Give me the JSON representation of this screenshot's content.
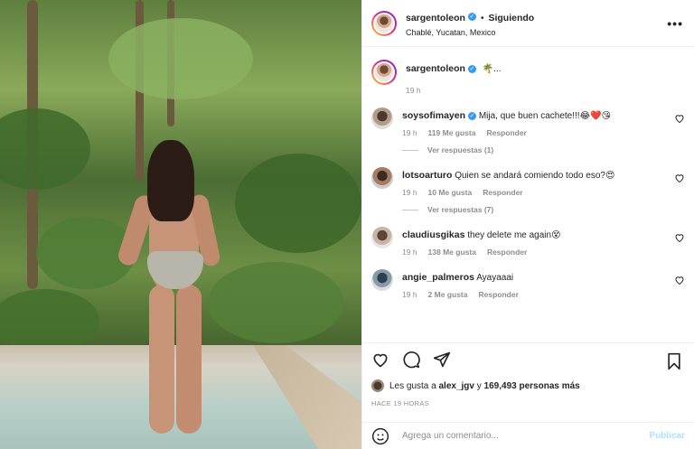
{
  "post": {
    "username": "sargentoleon",
    "following_label": "Siguiendo",
    "location": "Chablé, Yucatan, Mexico",
    "caption": "🌴...",
    "caption_time": "19 h"
  },
  "comments": [
    {
      "user": "soysofimayen",
      "verified": true,
      "text": "Mija, que buen cachete!!!😂❤️😘",
      "time": "19 h",
      "likes": "119 Me gusta",
      "reply": "Responder",
      "replies_label": "Ver respuestas (1)"
    },
    {
      "user": "lotsoarturo",
      "verified": false,
      "text": "Quien se andará comiendo todo eso?😍",
      "time": "19 h",
      "likes": "10 Me gusta",
      "reply": "Responder",
      "replies_label": "Ver respuestas (7)"
    },
    {
      "user": "claudiusgikas",
      "verified": false,
      "text": "they delete me again😵",
      "time": "19 h",
      "likes": "138 Me gusta",
      "reply": "Responder",
      "replies_label": ""
    },
    {
      "user": "angie_palmeros",
      "verified": false,
      "text": "Ayayaaai",
      "time": "19 h",
      "likes": "2 Me gusta",
      "reply": "Responder",
      "replies_label": ""
    }
  ],
  "likes_line": {
    "prefix": "Les gusta a",
    "user": "alex_jgv",
    "connector": "y",
    "count": "169,493 personas más"
  },
  "posted_ago": "HACE 19 HORAS",
  "add_comment": {
    "placeholder": "Agrega un comentario...",
    "publish_label": "Publicar"
  },
  "icons": {
    "more": "more-options-icon",
    "like": "heart-icon",
    "comment": "comment-bubble-icon",
    "share": "share-paper-plane-icon",
    "save": "bookmark-icon",
    "emoji": "emoji-smile-icon",
    "verified": "verified-badge-icon"
  },
  "colors": {
    "verified": "#3897f0",
    "publish_disabled": "#b2dffc",
    "muted_text": "#8e8e8e"
  }
}
